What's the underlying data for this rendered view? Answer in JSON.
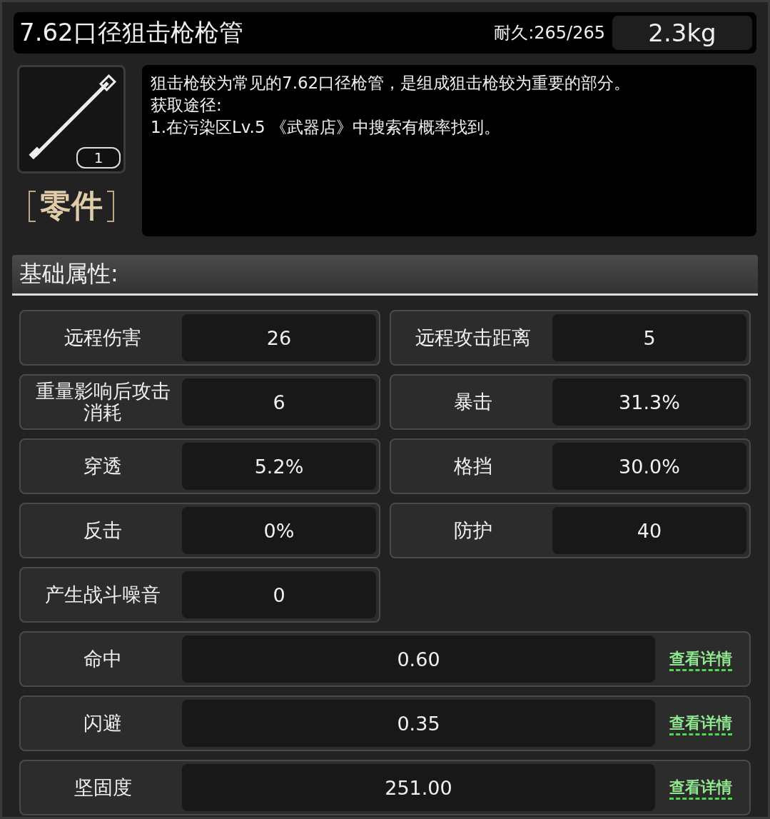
{
  "title": "7.62口径狙击枪枪管",
  "durability": "耐久:265/265",
  "weight": "2.3kg",
  "item": {
    "count": "1",
    "category": "零件"
  },
  "description": [
    "狙击枪较为常见的7.62口径枪管，是组成狙击枪较为重要的部分。",
    "获取途径:",
    "1.在污染区Lv.5 《武器店》中搜索有概率找到。"
  ],
  "section_title": "基础属性:",
  "pair_stats": [
    {
      "label": "远程伤害",
      "value": "26"
    },
    {
      "label": "远程攻击距离",
      "value": "5"
    },
    {
      "label": "重量影响后攻击消耗",
      "value": "6"
    },
    {
      "label": "暴击",
      "value": "31.3%"
    },
    {
      "label": "穿透",
      "value": "5.2%"
    },
    {
      "label": "格挡",
      "value": "30.0%"
    },
    {
      "label": "反击",
      "value": "0%"
    },
    {
      "label": "防护",
      "value": "40"
    },
    {
      "label": "产生战斗噪音",
      "value": "0"
    }
  ],
  "detail_stats": [
    {
      "label": "命中",
      "value": "0.60",
      "link": "查看详情"
    },
    {
      "label": "闪避",
      "value": "0.35",
      "link": "查看详情"
    },
    {
      "label": "坚固度",
      "value": "251.00",
      "link": "查看详情"
    }
  ]
}
